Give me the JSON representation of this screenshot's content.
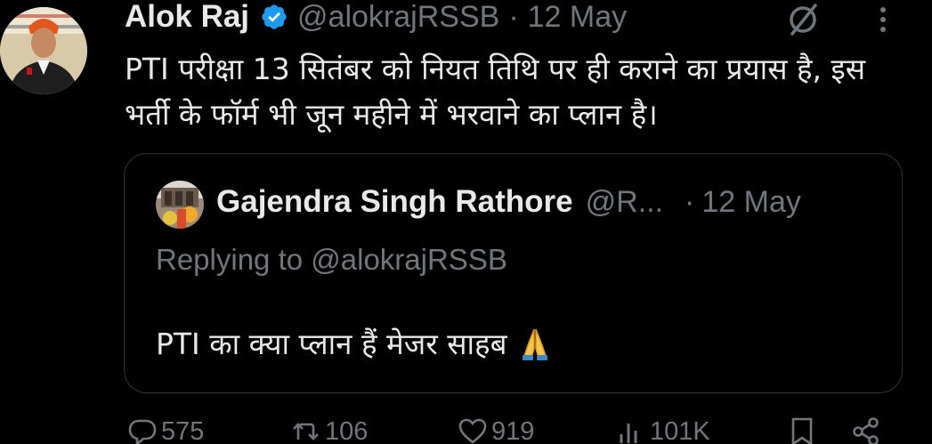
{
  "tweet": {
    "author_name": "Alok Raj",
    "handle": "@alokrajRSSB",
    "separator": "·",
    "date": "12 May",
    "text": "PTI परीक्षा 13 सितंबर को नियत तिथि पर ही कराने का प्रयास है, इस भर्ती के फॉर्म भी जून महीने में भरवाने का प्लान है।",
    "verified_color": "#1d9bf0"
  },
  "quote": {
    "author_name": "Gajendra Singh Rathore",
    "handle": "@R...",
    "separator": "·",
    "date": "12 May",
    "replying": "Replying to @alokrajRSSB",
    "text": "PTI का क्या प्लान हैं मेजर साहब"
  },
  "actions": {
    "replies": "575",
    "reposts": "106",
    "likes": "919",
    "views": "101K"
  },
  "colors": {
    "background": "#000000",
    "text": "#e7e9ea",
    "secondary": "#71767b",
    "border": "#2f3336"
  }
}
